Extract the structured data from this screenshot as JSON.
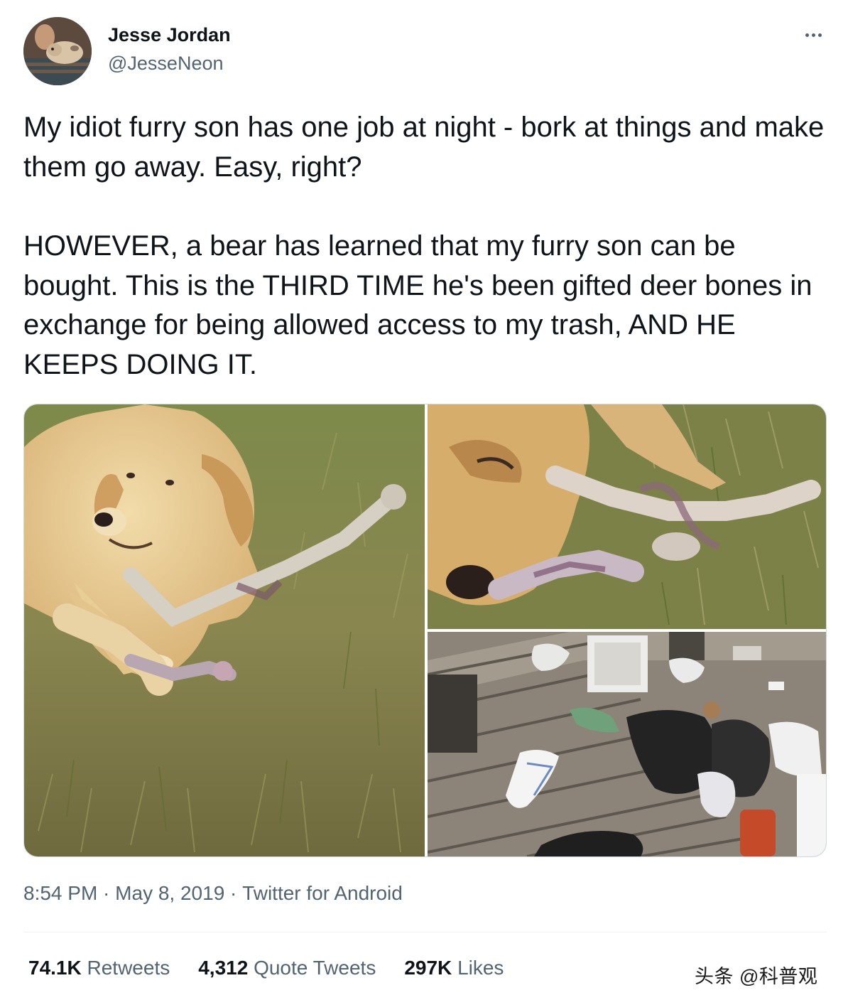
{
  "author": {
    "name": "Jesse Jordan",
    "handle": "@JesseNeon"
  },
  "tweet": {
    "paragraphs": [
      "My idiot furry son has one job at night - bork at things and make them go away. Easy, right?",
      "HOWEVER, a bear has learned that my furry son can be bought. This is the THIRD TIME he's been gifted deer bones in exchange for being allowed access to my trash, AND HE KEEPS DOING IT."
    ]
  },
  "media": [
    {
      "description": "dog lying on grass with a deer bone"
    },
    {
      "description": "dog chewing on a deer bone close-up"
    },
    {
      "description": "trash scattered across a wooden deck"
    }
  ],
  "meta": {
    "time": "8:54 PM",
    "separator": " · ",
    "date": "May 8, 2019",
    "source": "Twitter for Android"
  },
  "stats": [
    {
      "count": "74.1K",
      "label": "Retweets"
    },
    {
      "count": "4,312",
      "label": "Quote Tweets"
    },
    {
      "count": "297K",
      "label": "Likes"
    }
  ],
  "watermark": "头条 @科普观",
  "icons": {
    "more": "more-horizontal-icon"
  }
}
